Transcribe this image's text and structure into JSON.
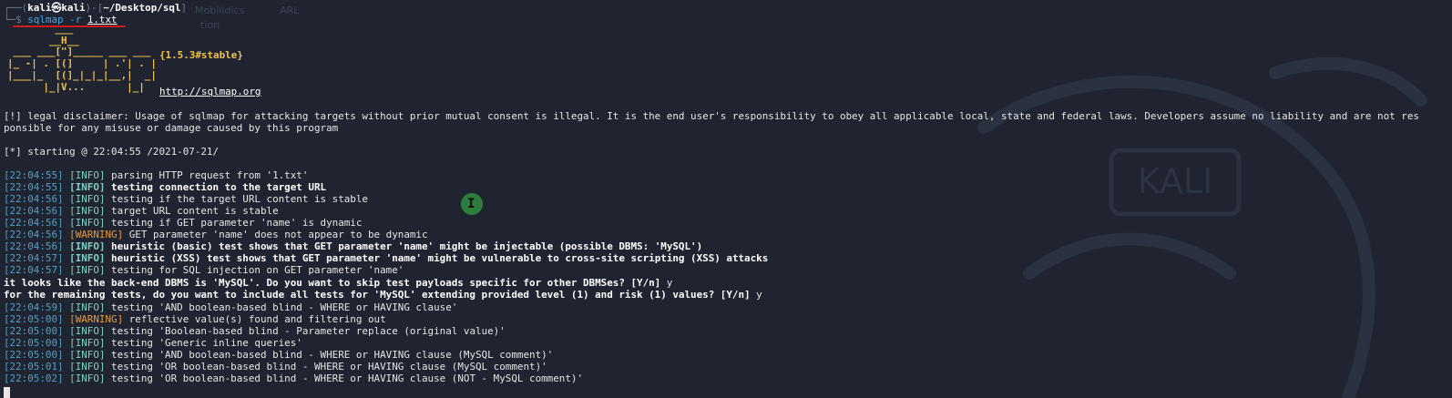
{
  "terminal": {
    "prompt": {
      "prefix": "┌──(",
      "user": "kali㉿kali",
      "mid": ")-[",
      "path": "~/Desktop/sql",
      "suffix": "]",
      "second_prefix": "└─$ ",
      "command": "sqlmap -r ",
      "command_arg": "1.txt"
    },
    "background_labels": [
      "Mobilidics",
      "ARL",
      "tion"
    ],
    "banner": {
      "version": "{1.5.3#stable}",
      "url": "http://sqlmap.org",
      "ascii_lines": [
        "        ___",
        "       __H__",
        " ___ ___[\"]_____ ___ ___",
        "|_ -| . [(]     | .'| . |",
        "|___|_  [(]_|_|_|__,|  _|",
        "      |_|V...       |_|"
      ]
    },
    "disclaimer_1": "[!] legal disclaimer: Usage of sqlmap for attacking targets without prior mutual consent is illegal. It is the end user's responsibility to obey all applicable local, state and federal laws. Developers assume no liability and are not res",
    "disclaimer_2": "ponsible for any misuse or damage caused by this program",
    "starting": "[*] starting @ 22:04:55 /2021-07-21/",
    "log": [
      {
        "ts": "[22:04:55]",
        "level": "[INFO]",
        "msg": " parsing HTTP request from '1.txt'",
        "bold": false
      },
      {
        "ts": "[22:04:55]",
        "level": "[INFO]",
        "msg": " testing connection to the target URL",
        "bold": true
      },
      {
        "ts": "[22:04:56]",
        "level": "[INFO]",
        "msg": " testing if the target URL content is stable",
        "bold": false
      },
      {
        "ts": "[22:04:56]",
        "level": "[INFO]",
        "msg": " target URL content is stable",
        "bold": false
      },
      {
        "ts": "[22:04:56]",
        "level": "[INFO]",
        "msg": " testing if GET parameter 'name' is dynamic",
        "bold": false
      },
      {
        "ts": "[22:04:56]",
        "level": "[WARNING]",
        "msg": " GET parameter 'name' does not appear to be dynamic",
        "bold": false
      },
      {
        "ts": "[22:04:56]",
        "level": "[INFO]",
        "msg": " heuristic (basic) test shows that GET parameter 'name' might be injectable (possible DBMS: 'MySQL')",
        "bold": true
      },
      {
        "ts": "[22:04:57]",
        "level": "[INFO]",
        "msg": " heuristic (XSS) test shows that GET parameter 'name' might be vulnerable to cross-site scripting (XSS) attacks",
        "bold": true
      },
      {
        "ts": "[22:04:57]",
        "level": "[INFO]",
        "msg": " testing for SQL injection on GET parameter 'name'",
        "bold": false
      }
    ],
    "question_1": "it looks like the back-end DBMS is 'MySQL'. Do you want to skip test payloads specific for other DBMSes? [Y/n]",
    "answer_1": " y",
    "question_2": "for the remaining tests, do you want to include all tests for 'MySQL' extending provided level (1) and risk (1) values? [Y/n]",
    "answer_2": " y",
    "log2": [
      {
        "ts": "[22:04:59]",
        "level": "[INFO]",
        "msg": " testing 'AND boolean-based blind - WHERE or HAVING clause'"
      },
      {
        "ts": "[22:05:00]",
        "level": "[WARNING]",
        "msg": " reflective value(s) found and filtering out"
      },
      {
        "ts": "[22:05:00]",
        "level": "[INFO]",
        "msg": " testing 'Boolean-based blind - Parameter replace (original value)'"
      },
      {
        "ts": "[22:05:00]",
        "level": "[INFO]",
        "msg": " testing 'Generic inline queries'"
      },
      {
        "ts": "[22:05:00]",
        "level": "[INFO]",
        "msg": " testing 'AND boolean-based blind - WHERE or HAVING clause (MySQL comment)'"
      },
      {
        "ts": "[22:05:01]",
        "level": "[INFO]",
        "msg": " testing 'OR boolean-based blind - WHERE or HAVING clause (MySQL comment)'"
      },
      {
        "ts": "[22:05:02]",
        "level": "[INFO]",
        "msg": " testing 'OR boolean-based blind - WHERE or HAVING clause (NOT - MySQL comment)'"
      }
    ],
    "watermark": "KALI",
    "colors": {
      "background": "#1f2430",
      "info": "#7fd0c4",
      "timestamp": "#4ea0c9",
      "warning": "#e69a3a",
      "banner": "#f0c24c",
      "underline_mark": "#d11a1a"
    }
  }
}
